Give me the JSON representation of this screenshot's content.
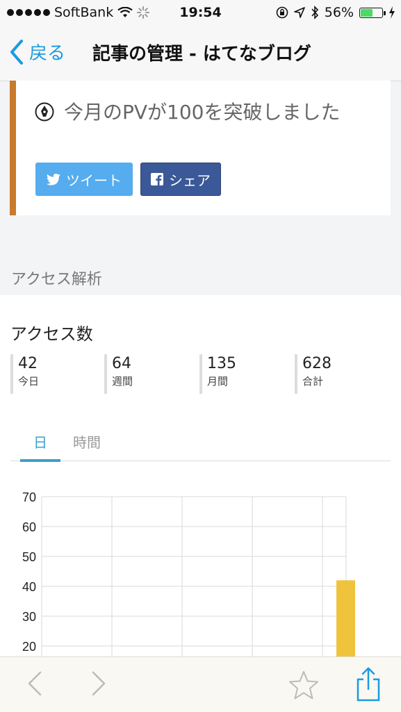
{
  "status_bar": {
    "carrier": "SoftBank",
    "time": "19:54",
    "battery": "56%",
    "battery_level": 0.56
  },
  "nav": {
    "back_label": "戻る",
    "title": "記事の管理 - はてなブログ"
  },
  "milestone": {
    "message": "今月のPVが100を突破しました",
    "tweet_label": "ツイート",
    "share_label": "シェア",
    "accent_color": "#c97a2c"
  },
  "analytics": {
    "section_label": "アクセス解析",
    "title": "アクセス数",
    "stats": [
      {
        "value": "42",
        "label": "今日"
      },
      {
        "value": "64",
        "label": "週間"
      },
      {
        "value": "135",
        "label": "月間"
      },
      {
        "value": "628",
        "label": "合計"
      }
    ],
    "tabs": [
      {
        "label": "日",
        "active": true
      },
      {
        "label": "時間",
        "active": false
      }
    ]
  },
  "chart_data": {
    "type": "bar",
    "y_ticks": [
      "70",
      "60",
      "50",
      "40",
      "30",
      "20"
    ],
    "ylim": [
      0,
      70
    ],
    "values": [
      42
    ],
    "bar_color": "#f0c33c",
    "grid": true
  },
  "toolbar": {
    "icons": [
      "back-arrow-icon",
      "forward-arrow-icon",
      "bookmark-star-icon",
      "share-icon"
    ]
  }
}
